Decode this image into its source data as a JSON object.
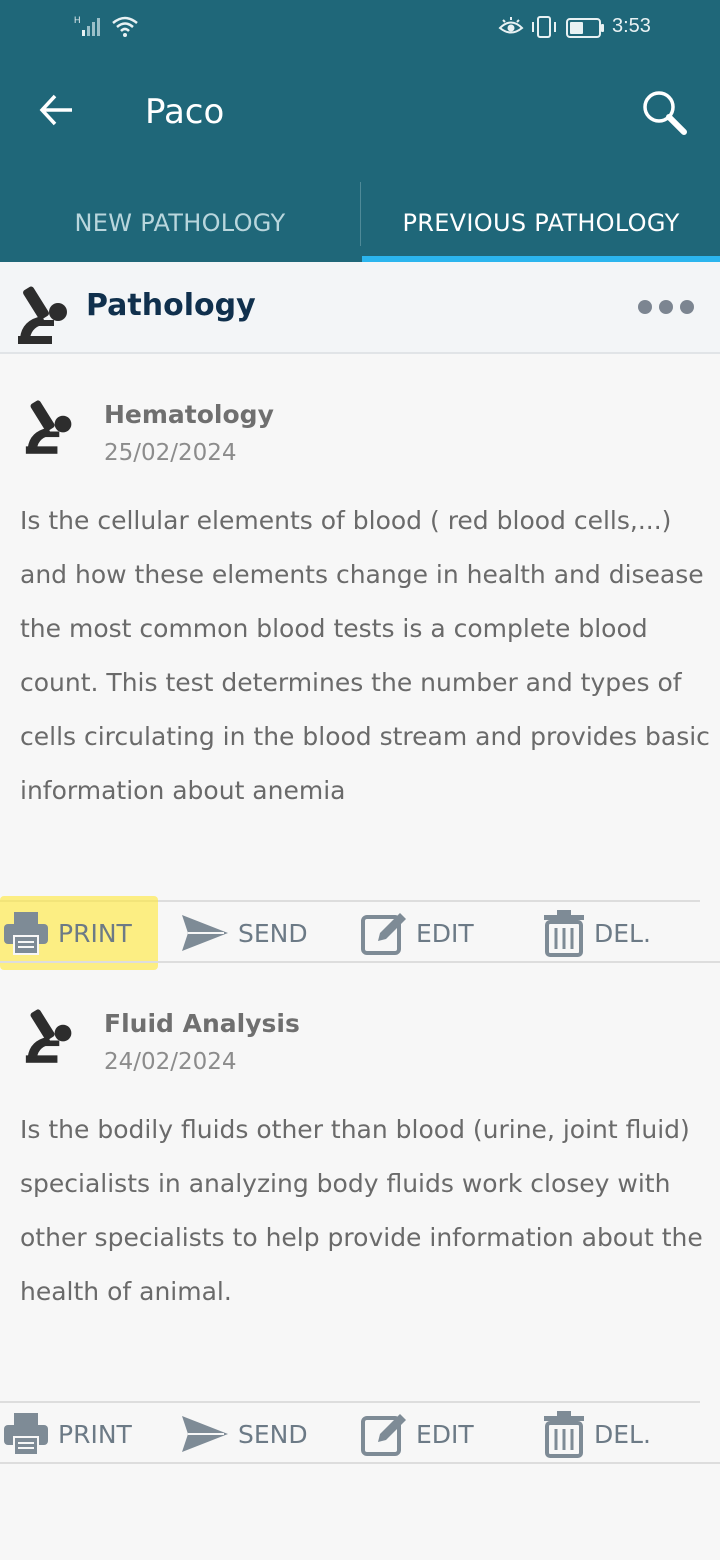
{
  "status_bar": {
    "time": "3:53",
    "signal_label": "H"
  },
  "toolbar": {
    "title": "Paco"
  },
  "tabs": [
    {
      "label": "NEW PATHOLOGY"
    },
    {
      "label": "PREVIOUS PATHOLOGY"
    }
  ],
  "section": {
    "title": "Pathology"
  },
  "records": [
    {
      "title": "Hematology",
      "date": "25/02/2024",
      "description": "Is the cellular elements of blood ( red blood cells,...) and how these elements change in health and disease the most common blood tests is a complete blood count. This test determines the number and types of cells circulating in the blood stream and provides basic information about anemia",
      "actions": {
        "print": "PRINT",
        "send": "SEND",
        "edit": "EDIT",
        "delete": "DEL."
      }
    },
    {
      "title": "Fluid Analysis",
      "date": "24/02/2024",
      "description": "Is the bodily fluids other than blood (urine, joint fluid) specialists in analyzing body fluids work closey with other specialists to help provide information about the health of animal.",
      "actions": {
        "print": "PRINT",
        "send": "SEND",
        "edit": "EDIT",
        "delete": "DEL."
      }
    }
  ],
  "colors": {
    "app_bar": "#1f6779",
    "tab_indicator": "#2bb5ee",
    "section_title": "#10304d",
    "action_icon": "#6c7a86",
    "highlight": "#ffe83c"
  },
  "icons": {
    "back": "arrow-left-icon",
    "search": "search-icon",
    "microscope": "microscope-icon",
    "more": "more-horizontal-icon",
    "print": "printer-icon",
    "send": "send-icon",
    "edit": "edit-icon",
    "delete": "trash-icon"
  }
}
